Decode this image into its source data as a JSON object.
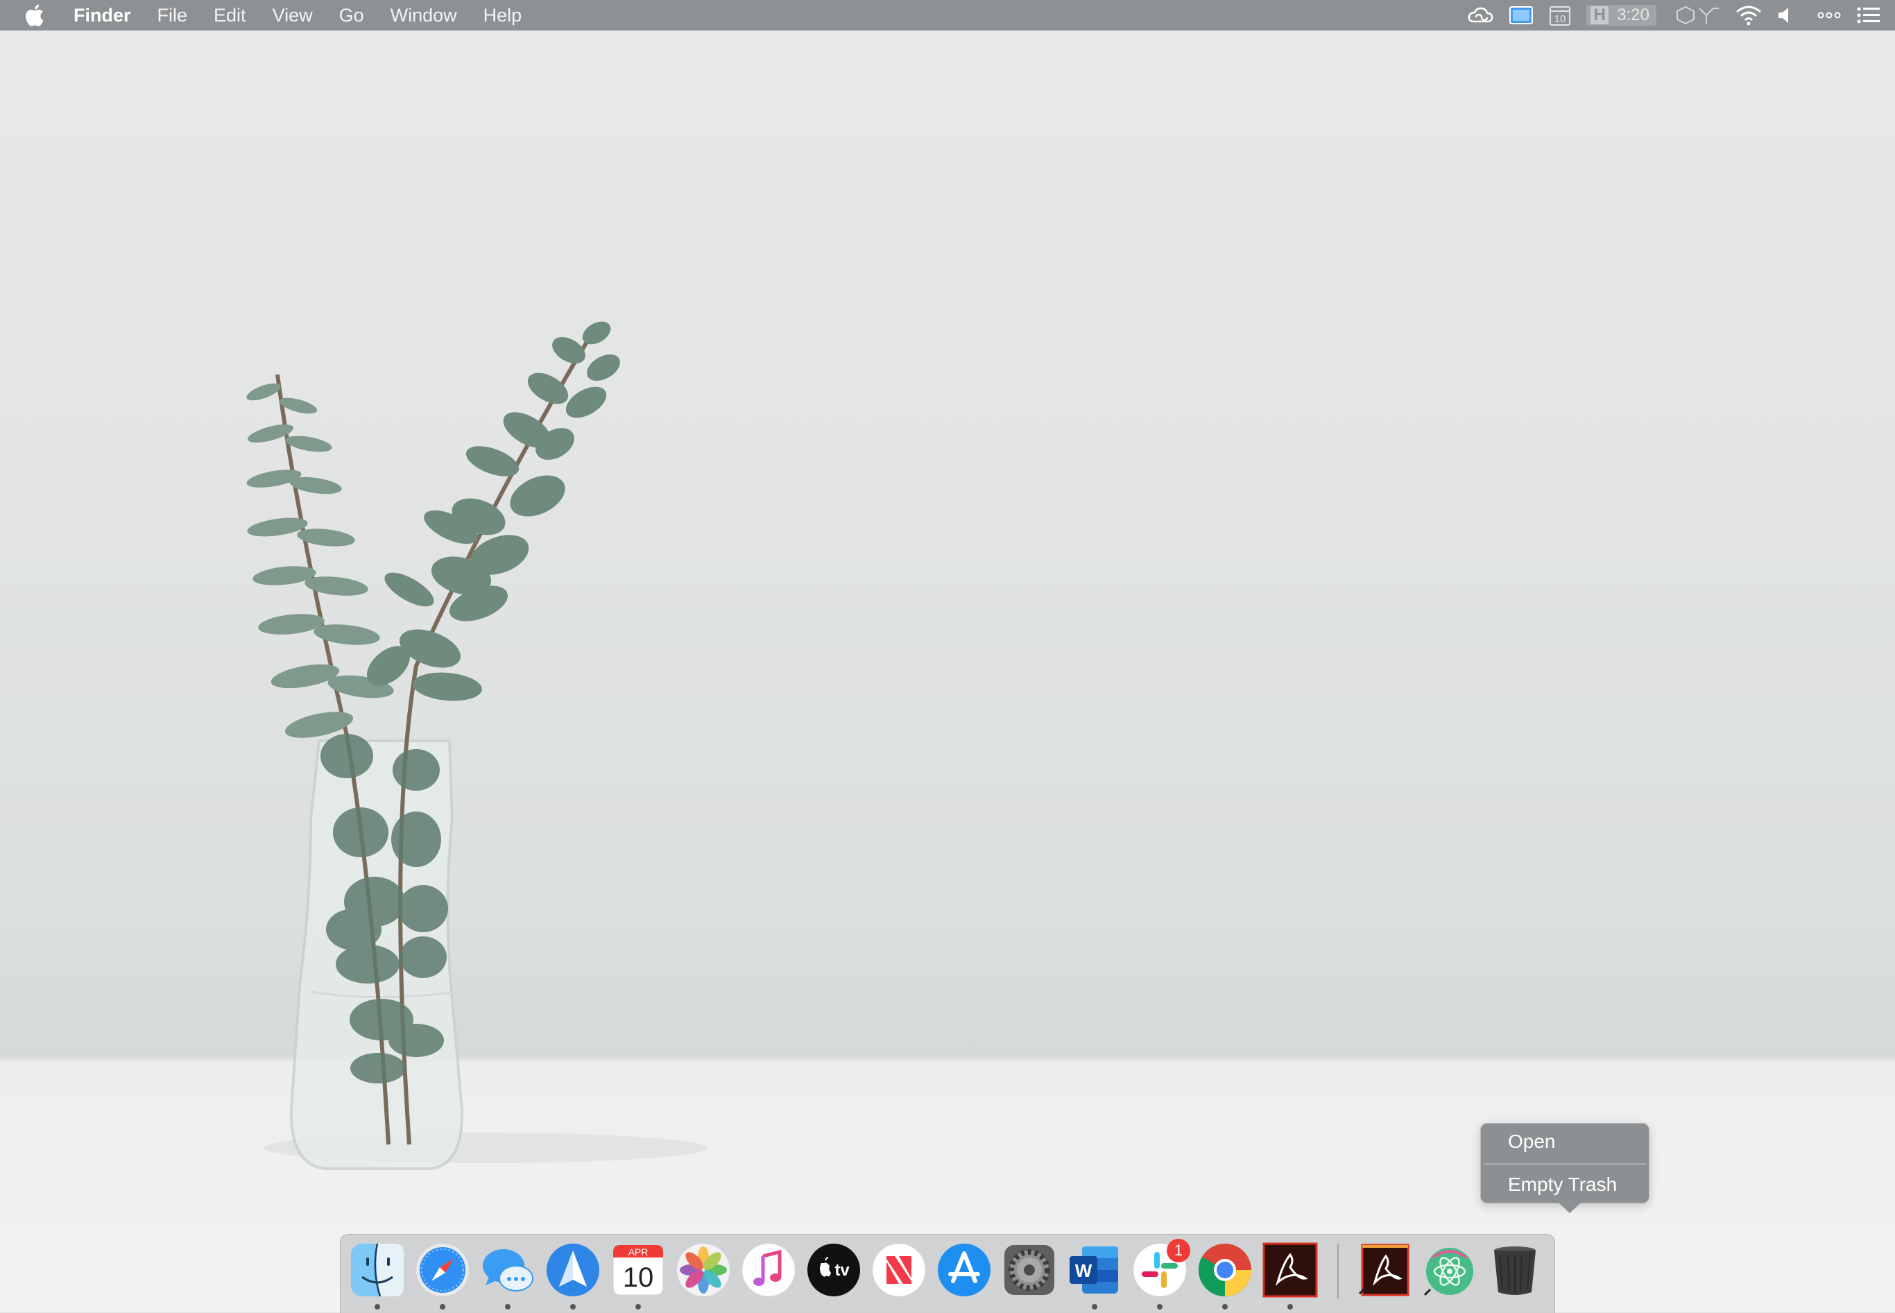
{
  "menubar": {
    "apple_icon": "apple-icon",
    "app_name": "Finder",
    "menus": [
      "File",
      "Edit",
      "View",
      "Go",
      "Window",
      "Help"
    ],
    "status_icons": [
      "creative-cloud-icon",
      "display-icon",
      "calendar-icon",
      "clock-widget",
      "airplay-icon",
      "wifi-icon",
      "volume-icon",
      "more-icon",
      "notification-center-icon"
    ],
    "clock_badge": "H",
    "clock": "3:20",
    "calendar_day": "10"
  },
  "context_menu": {
    "items": [
      "Open",
      "Empty Trash"
    ]
  },
  "dock": {
    "apps": [
      {
        "name": "Finder",
        "icon": "finder-icon",
        "running": true
      },
      {
        "name": "Safari",
        "icon": "safari-icon",
        "running": true
      },
      {
        "name": "Messages",
        "icon": "messages-icon",
        "running": true
      },
      {
        "name": "Spark",
        "icon": "spark-icon",
        "running": true
      },
      {
        "name": "Calendar",
        "icon": "calendar-icon",
        "running": true
      },
      {
        "name": "Photos",
        "icon": "photos-icon",
        "running": false
      },
      {
        "name": "Music",
        "icon": "music-icon",
        "running": false
      },
      {
        "name": "TV",
        "icon": "tv-icon",
        "running": false
      },
      {
        "name": "News",
        "icon": "news-icon",
        "running": false
      },
      {
        "name": "App Store",
        "icon": "app-store-icon",
        "running": false
      },
      {
        "name": "System Preferences",
        "icon": "system-preferences-icon",
        "running": false
      },
      {
        "name": "Microsoft Word",
        "icon": "word-icon",
        "running": true
      },
      {
        "name": "Slack",
        "icon": "slack-icon",
        "running": true
      },
      {
        "name": "Google Chrome",
        "icon": "chrome-icon",
        "running": true
      },
      {
        "name": "Adobe Acrobat",
        "icon": "acrobat-icon",
        "running": true
      }
    ],
    "others": [
      {
        "name": "Acrobat document",
        "icon": "acrobat-doc-icon"
      },
      {
        "name": "Atom",
        "icon": "atom-icon"
      },
      {
        "name": "Trash",
        "icon": "trash-icon"
      }
    ],
    "calendar_month": "APR",
    "calendar_day": "10",
    "slack_badge": "1",
    "tv_label": "tv",
    "word_letter": "W"
  },
  "colors": {
    "menubar": "#8e9193",
    "context_menu": "#8d9092",
    "badge": "#ef3b37"
  }
}
